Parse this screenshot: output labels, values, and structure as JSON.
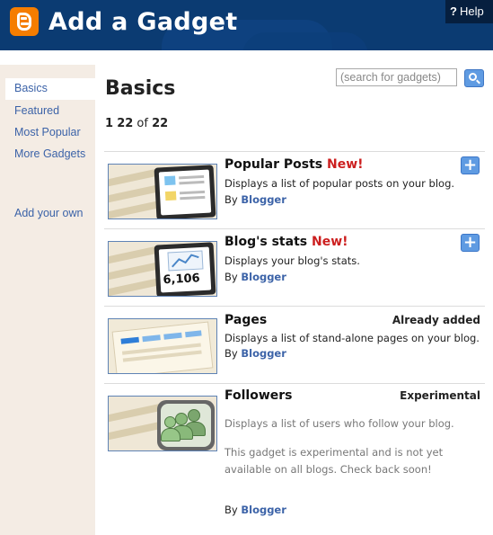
{
  "header": {
    "title": "Add a Gadget",
    "help_label": "Help"
  },
  "sidebar": {
    "items": [
      {
        "label": "Basics",
        "active": true
      },
      {
        "label": "Featured"
      },
      {
        "label": "Most Popular"
      },
      {
        "label": "More Gadgets"
      },
      {
        "label": "Add your own"
      }
    ]
  },
  "main": {
    "title": "Basics",
    "search_placeholder": "(search for gadgets)",
    "count": {
      "start": "1",
      "end": "22",
      "of": "of",
      "total": "22"
    }
  },
  "gadgets": [
    {
      "name": "Popular Posts",
      "new": "New!",
      "desc": "Displays a list of popular posts on your blog.",
      "by": "By",
      "author": "Blogger",
      "action": "add"
    },
    {
      "name": "Blog's stats",
      "new": "New!",
      "desc": "Displays your blog's stats.",
      "by": "By",
      "author": "Blogger",
      "action": "add",
      "thumb_number": "6,106"
    },
    {
      "name": "Pages",
      "status": "Already added",
      "desc": "Displays a list of stand-alone pages on your blog.",
      "by": "By",
      "author": "Blogger"
    },
    {
      "name": "Followers",
      "status": "Experimental",
      "desc": "Displays a list of users who follow your blog.",
      "note": "This gadget is experimental and is not yet available on all blogs. Check back soon!",
      "by": "By",
      "author": "Blogger"
    }
  ],
  "colors": {
    "header_bg": "#0b3b72",
    "link": "#3c63a8",
    "new": "#cc1f1f",
    "sidebar_bg": "#f4ece4",
    "accent_button": "#5f9be2"
  },
  "icons": {
    "logo": "blogger-logo-icon",
    "search": "search-icon",
    "add": "plus-icon"
  }
}
